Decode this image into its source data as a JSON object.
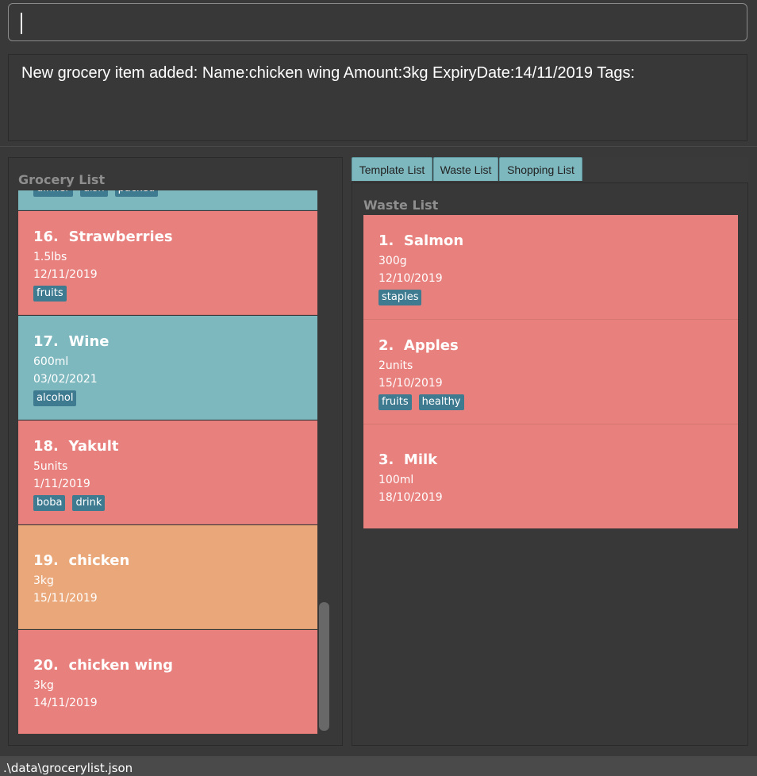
{
  "command_box": {
    "value": ""
  },
  "result_display": {
    "text": "New grocery item added: Name:chicken wing Amount:3kg ExpiryDate:14/11/2019 Tags:"
  },
  "grocery_list": {
    "title": "Grocery List",
    "partial_item": {
      "tags": [
        "dinner",
        "dish",
        "packed"
      ]
    },
    "items": [
      {
        "index": "16.",
        "name": "Strawberries",
        "amount": "1.5lbs",
        "expiry": "12/11/2019",
        "tags": [
          "fruits"
        ],
        "status": "red"
      },
      {
        "index": "17.",
        "name": "Wine",
        "amount": "600ml",
        "expiry": "03/02/2021",
        "tags": [
          "alcohol"
        ],
        "status": "teal"
      },
      {
        "index": "18.",
        "name": "Yakult",
        "amount": "5units",
        "expiry": "1/11/2019",
        "tags": [
          "boba",
          "drink"
        ],
        "status": "red"
      },
      {
        "index": "19.",
        "name": "chicken",
        "amount": "3kg",
        "expiry": "15/11/2019",
        "tags": [],
        "status": "orange"
      },
      {
        "index": "20.",
        "name": "chicken wing",
        "amount": "3kg",
        "expiry": "14/11/2019",
        "tags": [],
        "status": "red"
      }
    ]
  },
  "tabs": [
    {
      "label": "Template List"
    },
    {
      "label": "Waste List"
    },
    {
      "label": "Shopping List"
    }
  ],
  "waste_list": {
    "title": "Waste List",
    "items": [
      {
        "index": "1.",
        "name": "Salmon",
        "amount": "300g",
        "expiry": "12/10/2019",
        "tags": [
          "staples"
        ]
      },
      {
        "index": "2.",
        "name": "Apples",
        "amount": "2units",
        "expiry": "15/10/2019",
        "tags": [
          "fruits",
          "healthy"
        ]
      },
      {
        "index": "3.",
        "name": "Milk",
        "amount": "100ml",
        "expiry": "18/10/2019",
        "tags": []
      }
    ]
  },
  "status_bar": {
    "path": ".\\data\\grocerylist.json"
  },
  "colors": {
    "expired": "#e8807d",
    "fresh": "#7eb8bf",
    "expiring": "#eaa87a",
    "tag": "#3e7b91",
    "background": "#393939"
  }
}
